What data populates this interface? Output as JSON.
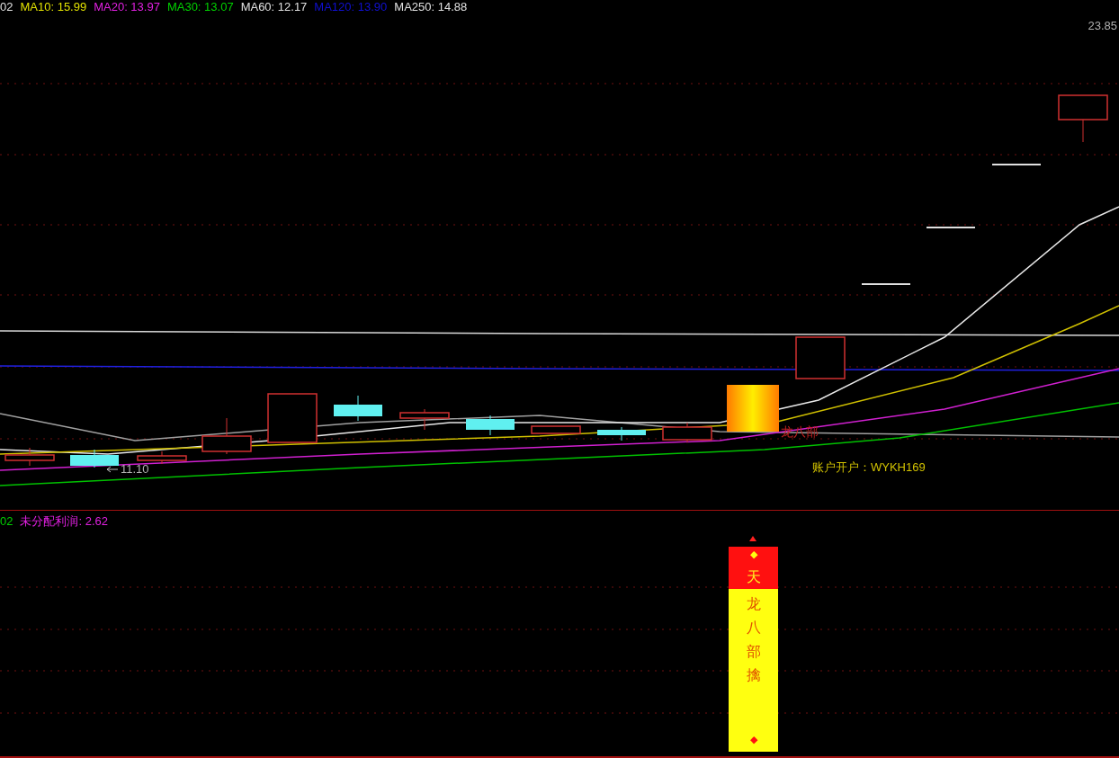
{
  "ma_legend": [
    {
      "label": "02",
      "color": "#e0e0e0"
    },
    {
      "label": "MA10: 15.99",
      "color": "#e0e000"
    },
    {
      "label": "MA20: 13.97",
      "color": "#e020e0"
    },
    {
      "label": "MA30: 13.07",
      "color": "#00d000"
    },
    {
      "label": "MA60: 12.17",
      "color": "#e0e0e0"
    },
    {
      "label": "MA120: 13.90",
      "color": "#1010d0"
    },
    {
      "label": "MA250: 14.88",
      "color": "#e0e0e0"
    }
  ],
  "price_label": "23.85",
  "low_marker": "11.10",
  "signal_label": "龙八部",
  "account_note": "账户开户：WYKH169",
  "indicator_legend": [
    {
      "label": "02",
      "color": "#00d000"
    },
    {
      "label": "未分配利润: 2.62",
      "color": "#e020e0"
    }
  ],
  "signal_column": {
    "top_mark": "◆",
    "top_text": "天",
    "text": "龙八部擒",
    "bottom_mark": "◆"
  }
}
